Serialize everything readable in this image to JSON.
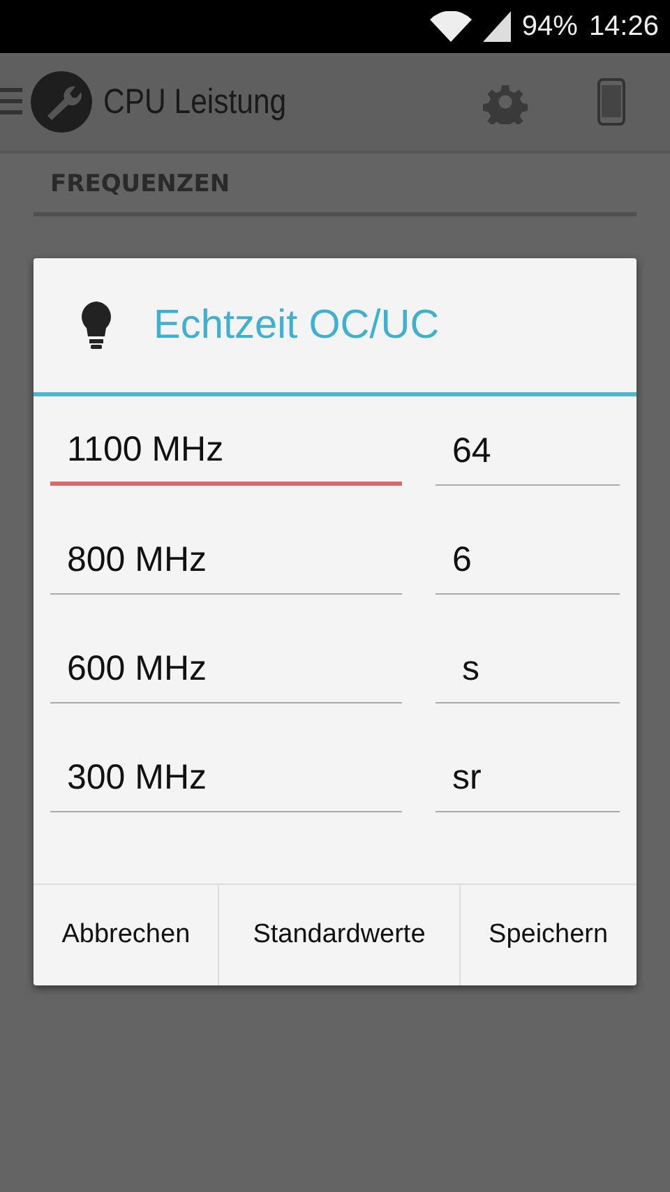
{
  "status_bar": {
    "battery": "94%",
    "time": "14:26"
  },
  "action_bar": {
    "title": "CPU Leistung"
  },
  "section": {
    "title": "FREQUENZEN"
  },
  "dialog": {
    "title": "Echtzeit OC/UC",
    "rows": [
      {
        "frequency": {
          "value": "1100 MHz",
          "focused": true
        },
        "setting": {
          "value": "64",
          "focused": false
        }
      },
      {
        "frequency": {
          "value": "800 MHz",
          "focused": false
        },
        "setting": {
          "value": "6",
          "focused": false
        }
      },
      {
        "frequency": {
          "value": "600 MHz",
          "focused": false
        },
        "setting": {
          "value": " s",
          "focused": false
        }
      },
      {
        "frequency": {
          "value": "300 MHz",
          "focused": false
        },
        "setting": {
          "value": "sr",
          "focused": false
        }
      }
    ],
    "buttons": [
      "Abbrechen",
      "Standardwerte",
      "Speichern"
    ]
  }
}
